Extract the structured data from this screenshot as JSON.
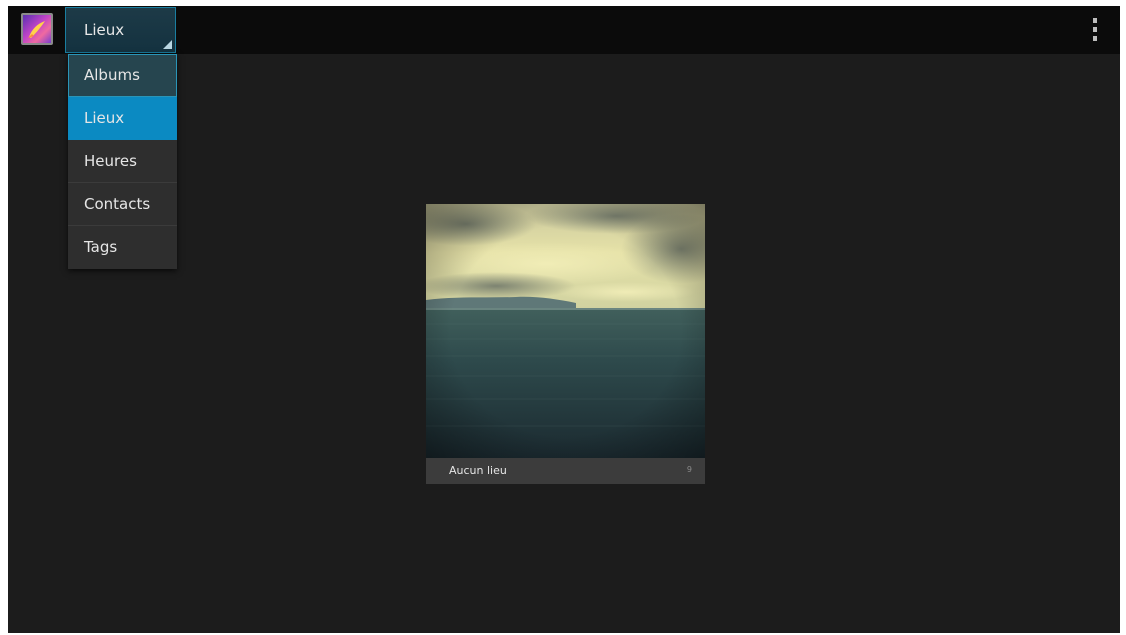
{
  "action_bar": {
    "app_icon": "gallery-app-icon",
    "spinner": {
      "selected_label": "Lieux"
    },
    "overflow_icon": "overflow-menu-icon"
  },
  "dropdown": {
    "items": [
      {
        "label": "Albums",
        "state": "focused"
      },
      {
        "label": "Lieux",
        "state": "selected"
      },
      {
        "label": "Heures",
        "state": "normal"
      },
      {
        "label": "Contacts",
        "state": "normal"
      },
      {
        "label": "Tags",
        "state": "normal"
      }
    ]
  },
  "albums": [
    {
      "name": "Aucun lieu",
      "count": "9"
    }
  ],
  "colors": {
    "background": "#1c1c1c",
    "action_bar": "#0b0b0b",
    "accent": "#0b8ac2",
    "caption": "#3c3c3c"
  }
}
